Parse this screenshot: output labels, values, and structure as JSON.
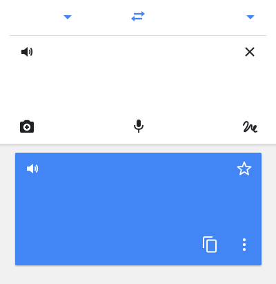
{
  "language_bar": {
    "source_language": "",
    "target_language": "",
    "dropdown_icon": "arrow-drop-down-icon",
    "swap_icon": "swap-horiz-icon"
  },
  "input": {
    "text": "",
    "placeholder": "",
    "speak_icon": "volume-up-icon",
    "clear_icon": "close-icon",
    "camera_icon": "camera-add-icon",
    "mic_icon": "mic-icon",
    "handwriting_icon": "handwriting-icon"
  },
  "result": {
    "text": "",
    "speak_icon": "volume-up-icon",
    "star_icon": "star-outline-icon",
    "copy_icon": "copy-icon",
    "more_icon": "more-vert-icon"
  },
  "colors": {
    "accent": "#4285f4",
    "icon_dark": "#202124",
    "background": "#f1f1f1",
    "divider": "#dadce0"
  }
}
